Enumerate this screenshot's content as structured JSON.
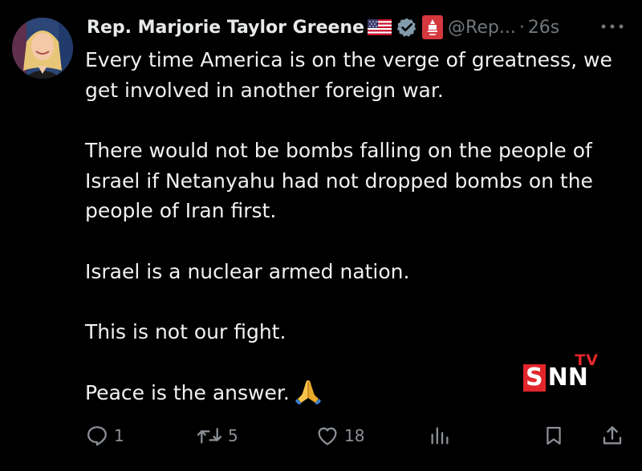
{
  "post": {
    "author_name": "Rep. Marjorie Taylor Greene",
    "handle": "@Rep...",
    "separator": "·",
    "time": "26s",
    "more_icon": "more-horizontal-icon",
    "paragraphs": [
      "Every time America is on the verge of greatness, we get involved in another foreign war.",
      "There would not be bombs falling on the people of Israel if Netanyahu had not dropped bombs on the people of Iran first.",
      "Israel is a nuclear armed nation.",
      "This is not our fight.",
      "Peace is the answer."
    ]
  },
  "actions": {
    "replies": "1",
    "reposts": "5",
    "likes": "18"
  },
  "watermark": {
    "tv": "TV",
    "s": "S",
    "nn": "NN"
  },
  "colors": {
    "background": "#000000",
    "text": "#e7e9ea",
    "muted": "#71767b",
    "verified_badge": "#829aab",
    "gov_badge": "#d4373e",
    "watermark_red": "#e3262b"
  }
}
